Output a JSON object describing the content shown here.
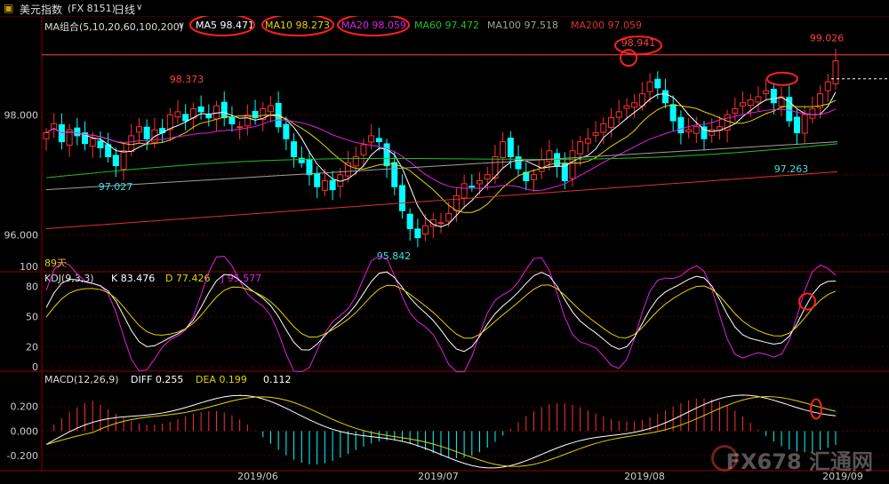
{
  "header": {
    "symbol_name": "美元指数",
    "symbol_code": "(FX 8151)",
    "period": "日线"
  },
  "main_legend": {
    "indicator": "MA组合(5,10,20,60,100,200)",
    "items": [
      {
        "label": "MA5 98.471",
        "color": "#ffffff"
      },
      {
        "label": "MA10 98.273",
        "color": "#e6d200"
      },
      {
        "label": "MA20 98.059",
        "color": "#e020e0"
      },
      {
        "label": "MA60 97.472",
        "color": "#20c020"
      },
      {
        "label": "MA100 97.518",
        "color": "#a0a0a0"
      },
      {
        "label": "MA200 97.059",
        "color": "#e03030"
      }
    ]
  },
  "price_axis": [
    "98.000",
    "96.000"
  ],
  "annotations": {
    "high1": "98.373",
    "low1": "97.027",
    "low2": "95.842",
    "high2": "98.941",
    "low3": "97.263",
    "high3": "99.026",
    "days": "89天"
  },
  "kdj_legend": {
    "indicator": "KDJ(9,3,3)",
    "k": "K 83.476",
    "d": "D 77.426",
    "j": "J 95.577",
    "k_color": "#ffffff",
    "d_color": "#e6d200",
    "j_color": "#e020e0"
  },
  "kdj_axis": [
    "100",
    "80",
    "50",
    "20",
    "0"
  ],
  "macd_legend": {
    "indicator": "MACD(12,26,9)",
    "diff": "DIFF 0.255",
    "dea": "DEA 0.199",
    "macd": "0.112"
  },
  "macd_axis": [
    "0.200",
    "0.000",
    "-0.200"
  ],
  "date_axis": [
    "2019/06",
    "2019/07",
    "2019/08",
    "2019/09"
  ],
  "watermark": "FX678 汇通网",
  "colors": {
    "up": "#ff3030",
    "down": "#00ffff",
    "grid": "#5a0000",
    "axis_text": "#cccccc"
  },
  "chart_data": {
    "type": "candlestick",
    "price_range": [
      95.5,
      99.5
    ],
    "closes": [
      97.7,
      97.85,
      97.55,
      97.75,
      97.65,
      97.52,
      97.6,
      97.45,
      97.3,
      97.15,
      97.4,
      97.65,
      97.8,
      97.6,
      97.75,
      97.7,
      98.0,
      98.05,
      97.9,
      98.1,
      98.05,
      97.95,
      98.15,
      97.95,
      97.85,
      97.8,
      98.0,
      97.95,
      98.1,
      98.15,
      97.8,
      97.6,
      97.3,
      97.2,
      97.0,
      96.8,
      96.9,
      96.75,
      97.0,
      97.2,
      97.3,
      97.5,
      97.65,
      97.55,
      97.15,
      96.8,
      96.4,
      96.1,
      95.95,
      96.15,
      96.25,
      96.2,
      96.35,
      96.65,
      96.85,
      96.8,
      96.9,
      97.0,
      97.3,
      97.55,
      97.3,
      97.1,
      96.9,
      97.0,
      97.25,
      97.4,
      97.15,
      96.9,
      97.4,
      97.55,
      97.6,
      97.7,
      97.85,
      97.95,
      98.05,
      98.15,
      98.2,
      98.35,
      98.55,
      98.45,
      98.2,
      97.9,
      97.7,
      97.75,
      97.8,
      97.6,
      97.75,
      97.8,
      98.0,
      98.1,
      98.2,
      98.25,
      98.3,
      98.4,
      98.2,
      98.3,
      97.9,
      97.7,
      98.0,
      98.1,
      98.35,
      98.55,
      98.9
    ]
  }
}
